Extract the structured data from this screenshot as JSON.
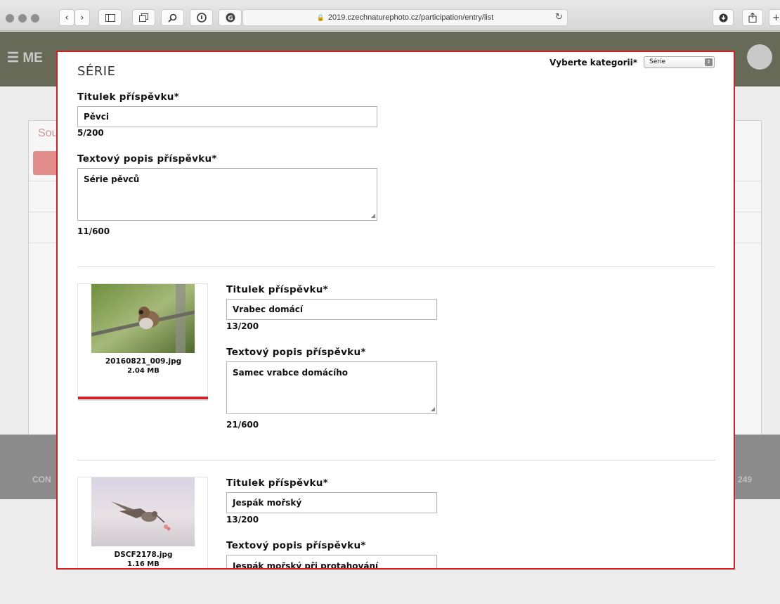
{
  "browser": {
    "url": "2019.czechnaturephoto.cz/participation/entry/list"
  },
  "background": {
    "menu_label": "ME",
    "panel_label": "Sou",
    "footer_left": "CON",
    "footer_right": "249"
  },
  "modal": {
    "heading": "SÉRIE",
    "category_label": "Vyberte kategorii*",
    "category_value": "Série",
    "series": {
      "title_label": "Titulek příspěvku*",
      "title_value": "Pěvci",
      "title_count": "5/200",
      "desc_label": "Textový popis příspěvku*",
      "desc_value": "Série pěvců",
      "desc_count": "11/600"
    },
    "photos": [
      {
        "filename": "20160821_009.jpg",
        "filesize": "2.04 MB",
        "title_label": "Titulek příspěvku*",
        "title_value": "Vrabec domácí",
        "title_count": "13/200",
        "desc_label": "Textový popis příspěvku*",
        "desc_value": "Samec vrabce domácího",
        "desc_count": "21/600"
      },
      {
        "filename": "DSCF2178.jpg",
        "filesize": "1.16 MB",
        "title_label": "Titulek příspěvku*",
        "title_value": "Jespák mořský",
        "title_count": "13/200",
        "desc_label": "Textový popis příspěvku*",
        "desc_value": "Jespák mořský při protahování"
      }
    ]
  }
}
